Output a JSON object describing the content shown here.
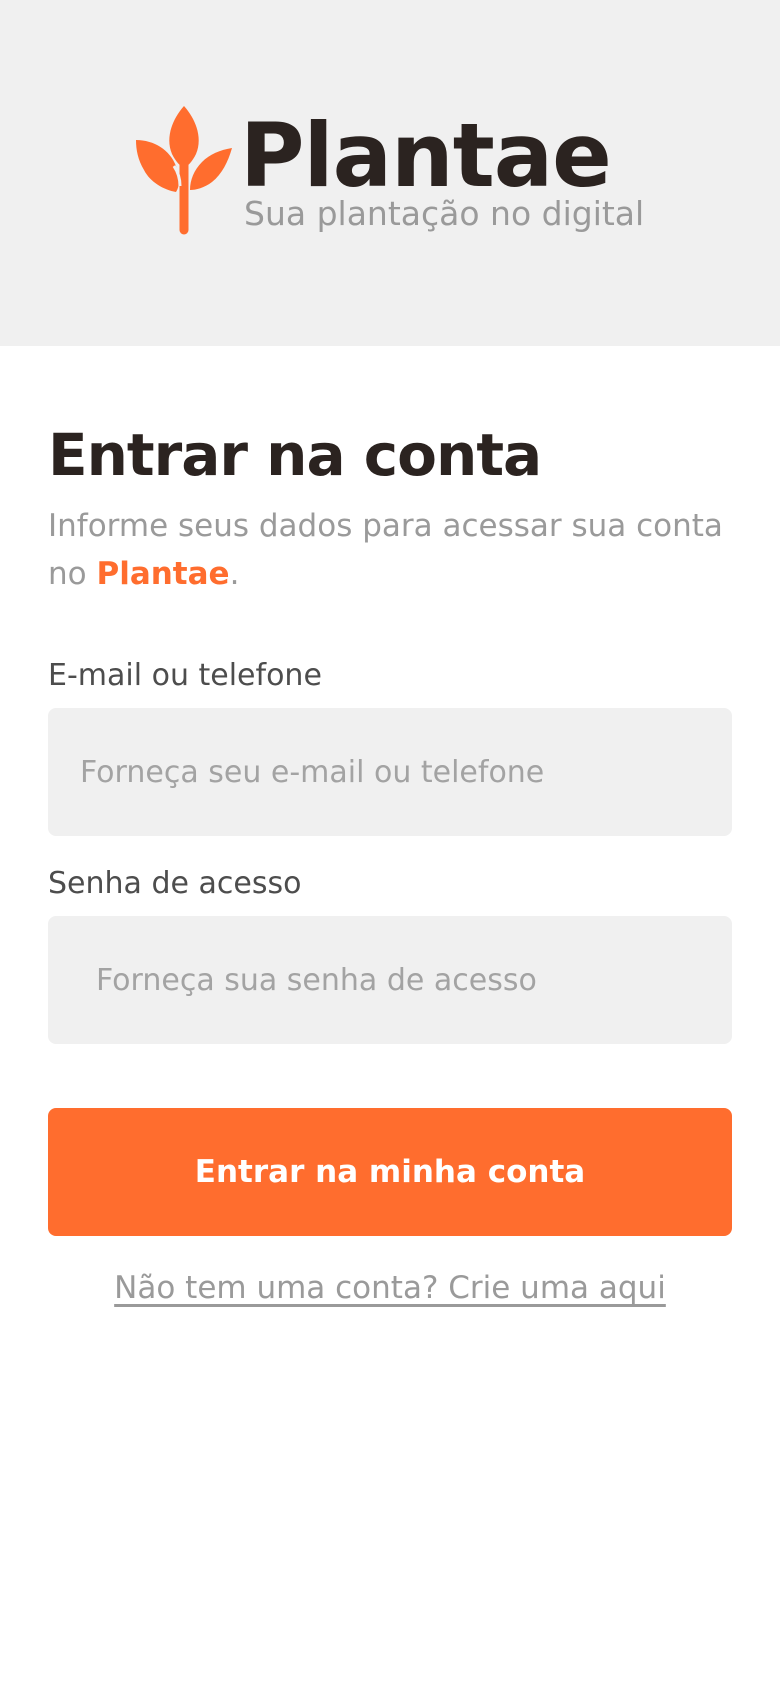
{
  "header": {
    "logo_icon": "sprout-icon",
    "brand_name": "Plantae",
    "tagline": "Sua plantação no digital"
  },
  "login": {
    "title": "Entrar na conta",
    "subtitle_prefix": "Informe seus dados para acessar sua conta no ",
    "subtitle_brand": "Plantae",
    "subtitle_suffix": ".",
    "email": {
      "label": "E-mail ou telefone",
      "placeholder": "Forneça seu e-mail ou telefone",
      "value": ""
    },
    "password": {
      "label": "Senha de acesso",
      "placeholder": "Forneça sua senha de acesso",
      "value": ""
    },
    "submit_label": "Entrar na minha conta",
    "signup_link": "Não tem uma conta? Crie uma aqui"
  },
  "colors": {
    "accent": "#ff6d2e",
    "header_bg": "#f0f0f0",
    "input_bg": "#f0f0f0",
    "text_dark": "#2b2320",
    "text_muted": "#9a9a9a"
  }
}
